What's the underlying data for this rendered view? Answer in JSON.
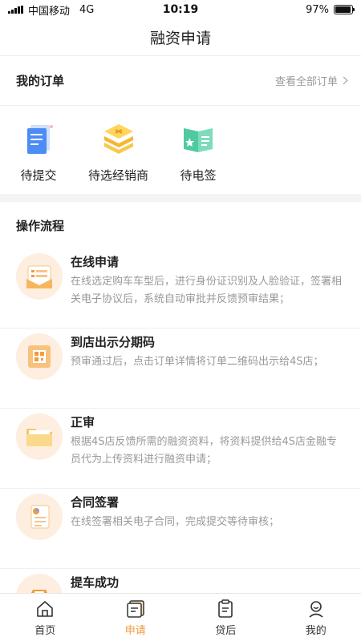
{
  "status_bar": {
    "carrier": "中国移动",
    "network": "4G",
    "time": "10:19",
    "battery_text": "97%",
    "battery_level": 0.97
  },
  "nav": {
    "title": "融资申请"
  },
  "orders": {
    "title": "我的订单",
    "view_all": "查看全部订单",
    "items": [
      {
        "label": "待提交",
        "icon": "document-icon"
      },
      {
        "label": "待选经销商",
        "icon": "layers-icon"
      },
      {
        "label": "待电签",
        "icon": "signature-book-icon"
      }
    ]
  },
  "process": {
    "title": "操作流程",
    "steps": [
      {
        "title": "在线申请",
        "desc": "在线选定购车车型后，进行身份证识别及人脸验证，签署相关电子协议后，系统自动审批并反馈预审结果；",
        "icon": "envelope-form-icon"
      },
      {
        "title": "到店出示分期码",
        "desc": "预审通过后，点击订单详情将订单二维码出示给4S店；",
        "icon": "qr-code-icon"
      },
      {
        "title": "正审",
        "desc": "根据4S店反馈所需的融资资料，将资料提供给4S店金融专员代为上传资料进行融资申请；",
        "icon": "folder-icon"
      },
      {
        "title": "合同签署",
        "desc": "在线签署相关电子合同，完成提交等待审核；",
        "icon": "contract-icon"
      },
      {
        "title": "提车成功",
        "desc": "",
        "icon": "car-icon"
      }
    ]
  },
  "tabs": [
    {
      "label": "首页",
      "icon": "home-icon"
    },
    {
      "label": "申请",
      "icon": "apply-icon",
      "active": true
    },
    {
      "label": "贷后",
      "icon": "clipboard-icon"
    },
    {
      "label": "我的",
      "icon": "profile-icon"
    }
  ],
  "colors": {
    "accent": "#f29a3d",
    "step_bg": "#fdeee0"
  }
}
